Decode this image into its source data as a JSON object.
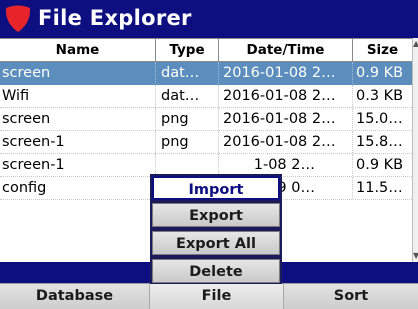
{
  "app": {
    "title": "File Explorer",
    "logo_icon": "red-shield-icon",
    "colors": {
      "titlebar": "#0d0f80",
      "selection": "#5b8dbd",
      "logo": "#e8242b"
    }
  },
  "table": {
    "columns": [
      "Name",
      "Type",
      "Date/Time",
      "Size"
    ],
    "rows": [
      {
        "name": "screen",
        "type": "dat…",
        "datetime": "2016-01-08 2…",
        "size": "0.9 KB",
        "selected": true
      },
      {
        "name": "Wifi",
        "type": "dat…",
        "datetime": "2016-01-08 2…",
        "size": "0.3 KB"
      },
      {
        "name": "screen",
        "type": "png",
        "datetime": "2016-01-08 2…",
        "size": "15.0…"
      },
      {
        "name": "screen-1",
        "type": "png",
        "datetime": "2016-01-08 2…",
        "size": "15.8…"
      },
      {
        "name": "screen-1",
        "type": "",
        "datetime": "1-08 2…",
        "size": "0.9 KB"
      },
      {
        "name": "config",
        "type": "",
        "datetime": "1-09 0…",
        "size": "11.5…"
      }
    ]
  },
  "popup_menu": {
    "items": [
      "Import",
      "Export",
      "Export All",
      "Delete"
    ],
    "selected": "Import"
  },
  "softkeys": [
    "Database",
    "File",
    "Sort"
  ]
}
